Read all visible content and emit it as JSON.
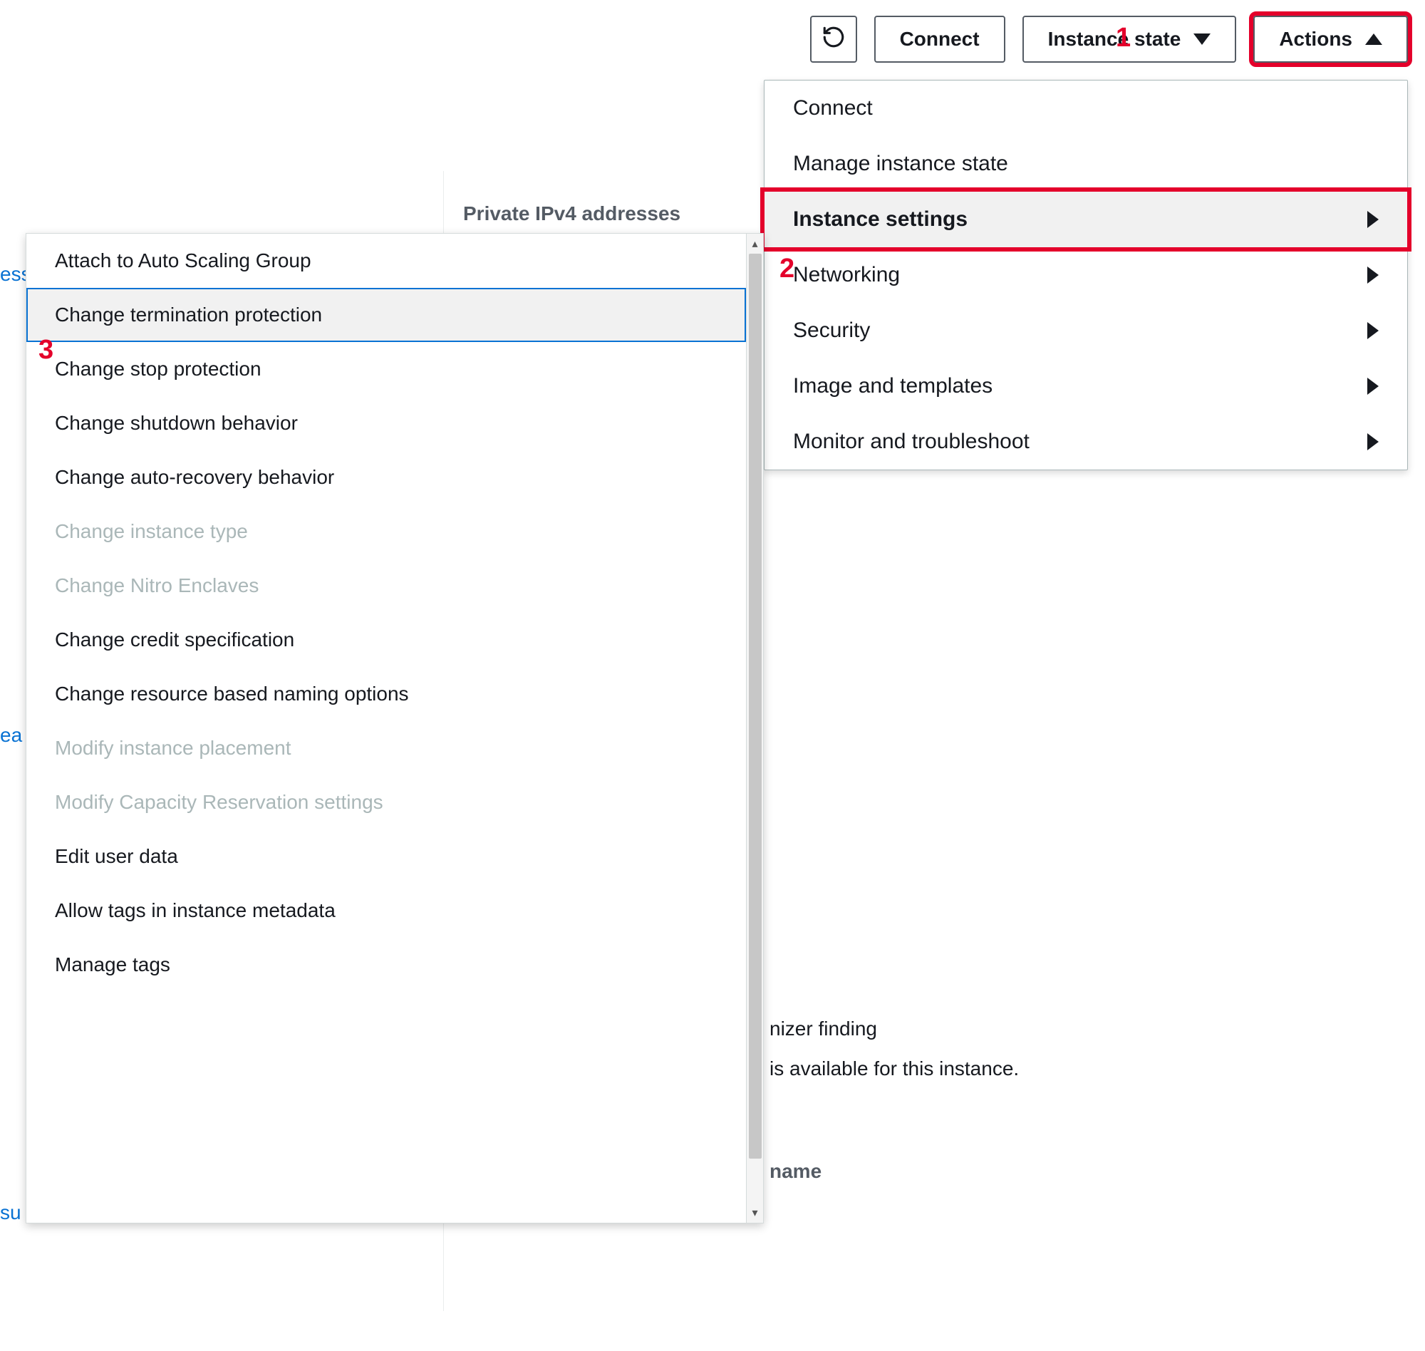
{
  "toolbar": {
    "connect_label": "Connect",
    "instance_state_label": "Instance state",
    "actions_label": "Actions"
  },
  "background": {
    "private_ipv4_label": "Private IPv4 addresses",
    "finding_text_1": "nizer finding",
    "finding_text_2": "is available for this instance.",
    "name_label": "name",
    "left_fragment_1": "ess",
    "left_fragment_2": "ea",
    "left_fragment_3": "su"
  },
  "actions_menu": [
    {
      "label": "Connect",
      "submenu": false
    },
    {
      "label": "Manage instance state",
      "submenu": false
    },
    {
      "label": "Instance settings",
      "submenu": true,
      "hovered": true
    },
    {
      "label": "Networking",
      "submenu": true
    },
    {
      "label": "Security",
      "submenu": true
    },
    {
      "label": "Image and templates",
      "submenu": true
    },
    {
      "label": "Monitor and troubleshoot",
      "submenu": true
    }
  ],
  "sub_menu": [
    {
      "label": "Attach to Auto Scaling Group",
      "disabled": false
    },
    {
      "label": "Change termination protection",
      "disabled": false,
      "selected": true
    },
    {
      "label": "Change stop protection",
      "disabled": false
    },
    {
      "label": "Change shutdown behavior",
      "disabled": false
    },
    {
      "label": "Change auto-recovery behavior",
      "disabled": false
    },
    {
      "label": "Change instance type",
      "disabled": true
    },
    {
      "label": "Change Nitro Enclaves",
      "disabled": true
    },
    {
      "label": "Change credit specification",
      "disabled": false
    },
    {
      "label": "Change resource based naming options",
      "disabled": false
    },
    {
      "label": "Modify instance placement",
      "disabled": true
    },
    {
      "label": "Modify Capacity Reservation settings",
      "disabled": true
    },
    {
      "label": "Edit user data",
      "disabled": false
    },
    {
      "label": "Allow tags in instance metadata",
      "disabled": false
    },
    {
      "label": "Manage tags",
      "disabled": false
    }
  ],
  "annotations": {
    "1": "1",
    "2": "2",
    "3": "3"
  }
}
